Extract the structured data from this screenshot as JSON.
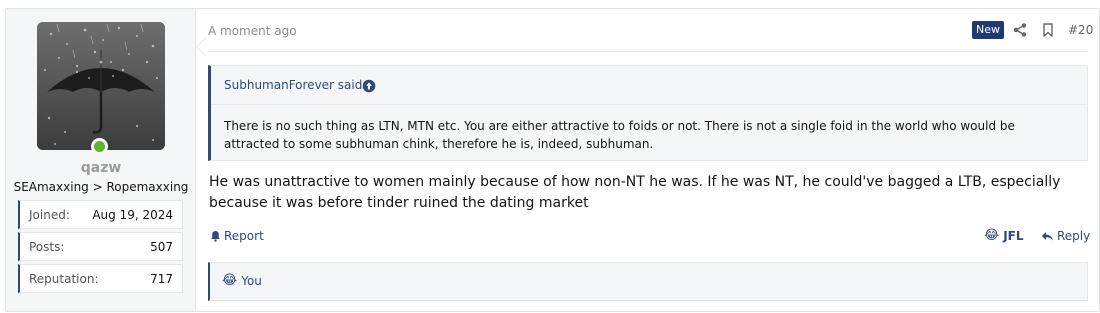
{
  "user": {
    "name": "qazw",
    "title": "SEAmaxxing > Ropemaxxing",
    "stats": [
      {
        "label": "Joined:",
        "value": "Aug 19, 2024"
      },
      {
        "label": "Posts:",
        "value": "507"
      },
      {
        "label": "Reputation:",
        "value": "717"
      }
    ],
    "online_color": "#5fb32d"
  },
  "post": {
    "timestamp": "A moment ago",
    "badge": "New",
    "number": "#20",
    "quote": {
      "author": "SubhumanForever said:",
      "text": "There is no such thing as LTN, MTN etc. You are either attractive to foids or not. There is not a single foid in the world who would be attracted to some subhuman chink, therefore he is, indeed, subhuman."
    },
    "message": "He was unattractive to women mainly because of how non-NT he was. If he was NT, he could've bagged a LTB, especially because it was before tinder ruined the dating market",
    "actions": {
      "report": "Report",
      "reaction": "JFL",
      "reply": "Reply"
    },
    "reactions_summary": "You"
  },
  "colors": {
    "accent": "#2f4a7a",
    "badge_bg": "#1f3a73",
    "panel_bg": "#f5f6f8"
  },
  "icons": {
    "share": "share-icon",
    "bookmark": "bookmark-icon",
    "quote_jump": "arrow-up-circle-icon",
    "report": "bell-icon",
    "reaction": "laughing-tears-emoji-icon",
    "reply": "reply-arrow-icon"
  }
}
